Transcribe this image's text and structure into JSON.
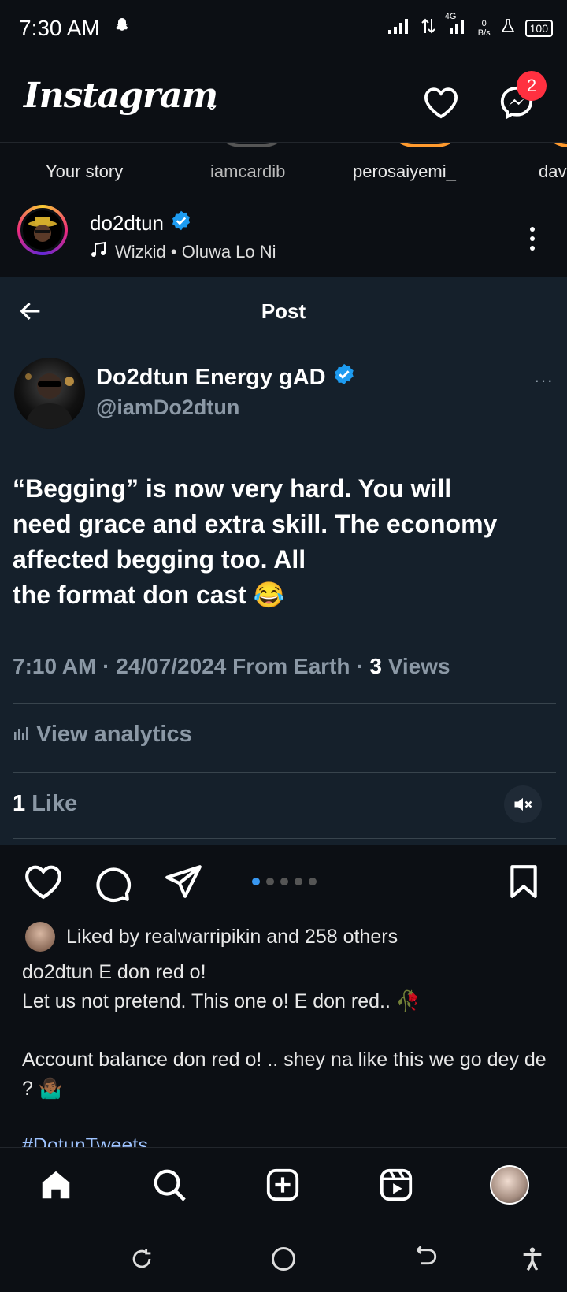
{
  "status": {
    "time": "7:30 AM",
    "network": "4G",
    "speed": "0",
    "speed_unit": "B/s",
    "battery": "100"
  },
  "header": {
    "logo": "Instagram",
    "caret": "⌄",
    "messages_badge": "2"
  },
  "stories": [
    "Your story",
    "iamcardib",
    "perosaiyemi_",
    "dav"
  ],
  "post": {
    "username": "do2dtun",
    "song": "Wizkid • Oluwa Lo Ni"
  },
  "tweet": {
    "bar_title": "Post",
    "name": "Do2dtun Energy gAD",
    "handle": "@iamDo2dtun",
    "more": "···",
    "text_lines": [
      "“Begging” is now very hard. You will",
      "need grace and extra skill. The economy",
      "affected begging too. All",
      "the format don cast 😂"
    ],
    "meta_prefix": "7:10 AM · 24/07/2024 From Earth · ",
    "views_count": "3",
    "views_label": " Views",
    "analytics": "View analytics",
    "likes_count": "1",
    "likes_label": " Like"
  },
  "carousel": {
    "count": 5,
    "active_index": 0
  },
  "liked_by": "Liked by realwarripikin and 258 others",
  "caption_lines": [
    "do2dtun E don red o!",
    "Let us not pretend. This one o! E don red.. 🥀",
    "",
    "Account balance don red o! .. shey na like this we go dey de ? 🤷🏾‍♂️"
  ],
  "hashtag": "#DotunTweets",
  "icons": {
    "heart": "heart-icon",
    "messenger": "messenger-icon",
    "comment": "comment-icon",
    "share": "share-icon",
    "bookmark": "bookmark-icon",
    "home": "home-icon",
    "search": "search-icon",
    "create": "create-icon",
    "reels": "reels-icon"
  },
  "colors": {
    "badge": "#ff3040",
    "verified": "#1d9bf0",
    "tweet_bg": "#15202b",
    "carousel_active": "#3897f0",
    "story_ring": "#ff9a2e"
  }
}
